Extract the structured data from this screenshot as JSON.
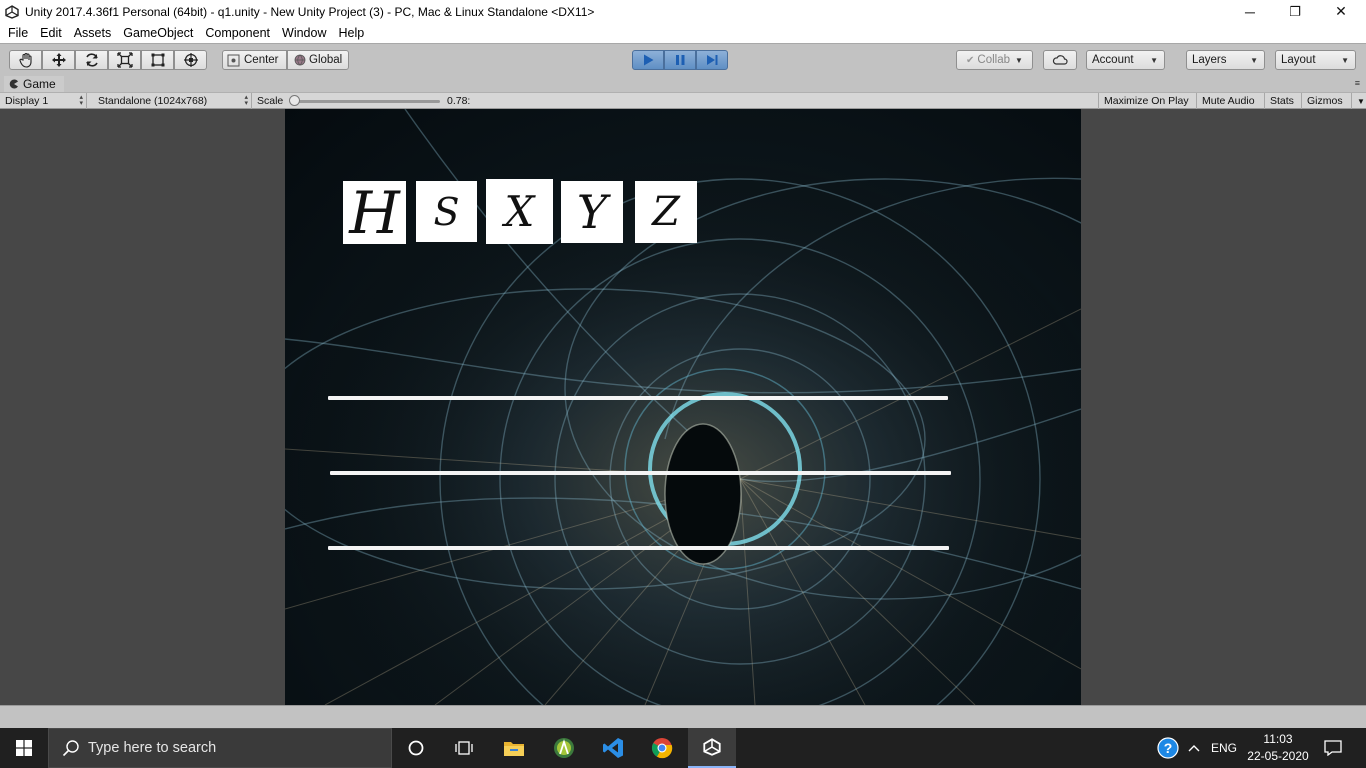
{
  "window": {
    "title": "Unity 2017.4.36f1 Personal (64bit) - q1.unity - New Unity Project (3) - PC, Mac & Linux Standalone <DX11>",
    "minimize": "─",
    "restore": "❐",
    "close": "✕"
  },
  "menu": {
    "items": [
      "File",
      "Edit",
      "Assets",
      "GameObject",
      "Component",
      "Window",
      "Help"
    ]
  },
  "toolbar": {
    "pivot_label": "Center",
    "space_label": "Global",
    "collab_label": "Collab",
    "account_label": "Account",
    "layers_label": "Layers",
    "layout_label": "Layout",
    "play_active": true,
    "accent_color": "#4a7dbf"
  },
  "game_tab": {
    "label": "Game",
    "menu_glyph": "≡"
  },
  "game_controls": {
    "display": "Display 1",
    "resolution": "Standalone (1024x768)",
    "scale_label": "Scale",
    "scale_value": "0.78:",
    "scale_fraction": 0.0,
    "maximize_on_play": "Maximize On Play",
    "mute_audio": "Mute Audio",
    "stats": "Stats",
    "gizmos": "Gizmos"
  },
  "game": {
    "letter_cards": [
      {
        "glyph": "H"
      },
      {
        "glyph": "S"
      },
      {
        "glyph": "X"
      },
      {
        "glyph": "Y"
      },
      {
        "glyph": "Z"
      }
    ],
    "answer_lines": 3
  },
  "taskbar": {
    "search_placeholder": "Type here to search",
    "language": "ENG",
    "time": "11:03",
    "date": "22-05-2020"
  }
}
